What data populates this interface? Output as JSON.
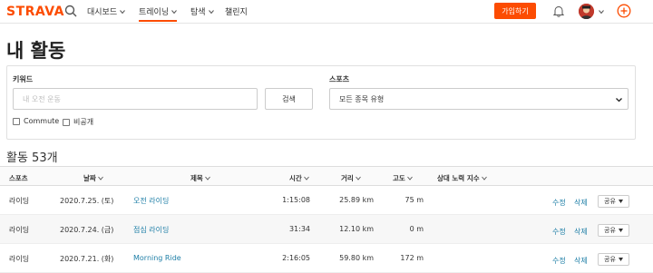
{
  "nav": {
    "logo": "STRAVA",
    "items": [
      {
        "label": "대시보드",
        "has_dropdown": true
      },
      {
        "label": "트레이닝",
        "has_dropdown": true,
        "active": true
      },
      {
        "label": "탐색",
        "has_dropdown": true
      },
      {
        "label": "챌린지",
        "has_dropdown": false
      }
    ],
    "signup_label": "가입하기",
    "accent_color": "#fc4c02"
  },
  "page": {
    "title": "내 활동"
  },
  "filters": {
    "keyword_label": "키워드",
    "keyword_placeholder": "내 오전 운동",
    "keyword_value": "",
    "search_label": "검색",
    "sport_label": "스포츠",
    "sport_selected": "모든 종목 유형",
    "commute_label": "Commute",
    "commute_checked": false,
    "private_label": "비공개",
    "private_checked": false
  },
  "activities": {
    "count_label": "활동 53개",
    "columns": {
      "sport": "스포츠",
      "date": "날짜",
      "title": "제목",
      "time": "시간",
      "distance": "거리",
      "elevation": "고도",
      "relative_effort": "상대 노력 지수"
    },
    "rows": [
      {
        "sport": "라이딩",
        "date": "2020.7.25. (토)",
        "title": "오전 라이딩",
        "time": "1:15:08",
        "distance": "25.89 km",
        "elevation": "75 m",
        "edit": "수정",
        "delete": "삭제",
        "share": "공유"
      },
      {
        "sport": "라이딩",
        "date": "2020.7.24. (금)",
        "title": "점심 라이딩",
        "time": "31:34",
        "distance": "12.10 km",
        "elevation": "0 m",
        "edit": "수정",
        "delete": "삭제",
        "share": "공유"
      },
      {
        "sport": "라이딩",
        "date": "2020.7.21. (화)",
        "title": "Morning Ride",
        "time": "2:16:05",
        "distance": "59.80 km",
        "elevation": "172 m",
        "edit": "수정",
        "delete": "삭제",
        "share": "공유"
      }
    ]
  }
}
